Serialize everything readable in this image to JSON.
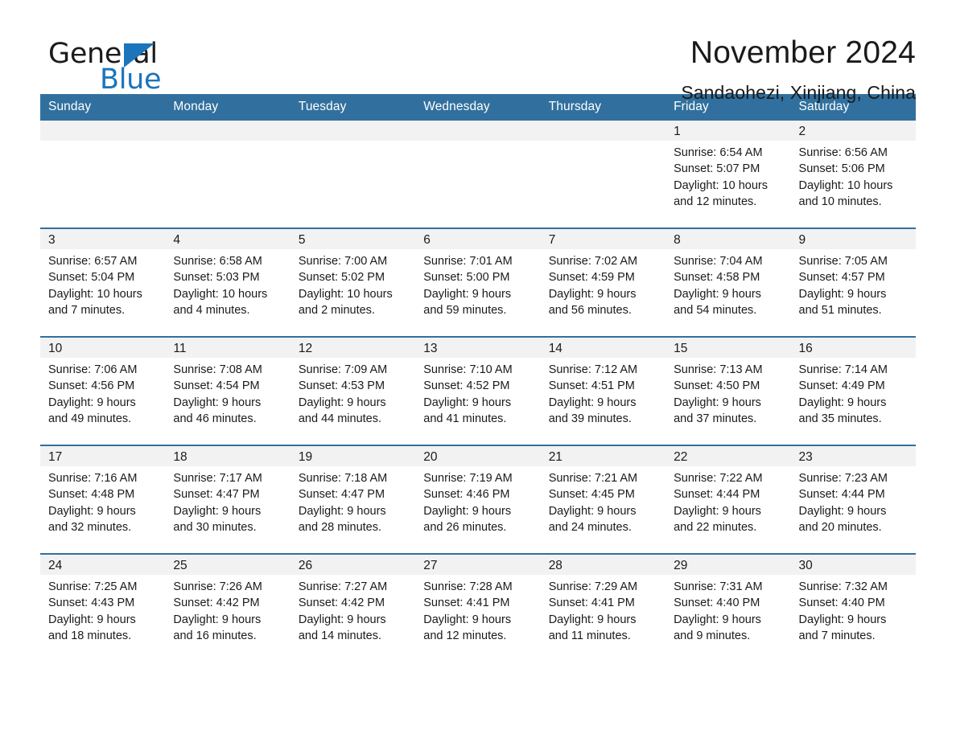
{
  "brand": {
    "name_part1": "General",
    "name_part2": "Blue",
    "triangle_color": "#1b75bb"
  },
  "header": {
    "month_title": "November 2024",
    "location": "Sandaohezi, Xinjiang, China"
  },
  "theme": {
    "header_blue": "#31709e",
    "daynum_band": "#f2f2f2",
    "page_background": "#ffffff"
  },
  "calendar": {
    "weekday_headers": [
      "Sunday",
      "Monday",
      "Tuesday",
      "Wednesday",
      "Thursday",
      "Friday",
      "Saturday"
    ],
    "weeks": [
      [
        {
          "day": "",
          "sunrise": "",
          "sunset": "",
          "daylight": "",
          "empty": true
        },
        {
          "day": "",
          "sunrise": "",
          "sunset": "",
          "daylight": "",
          "empty": true
        },
        {
          "day": "",
          "sunrise": "",
          "sunset": "",
          "daylight": "",
          "empty": true
        },
        {
          "day": "",
          "sunrise": "",
          "sunset": "",
          "daylight": "",
          "empty": true
        },
        {
          "day": "",
          "sunrise": "",
          "sunset": "",
          "daylight": "",
          "empty": true
        },
        {
          "day": "1",
          "sunrise": "Sunrise: 6:54 AM",
          "sunset": "Sunset: 5:07 PM",
          "daylight": "Daylight: 10 hours and 12 minutes.",
          "empty": false
        },
        {
          "day": "2",
          "sunrise": "Sunrise: 6:56 AM",
          "sunset": "Sunset: 5:06 PM",
          "daylight": "Daylight: 10 hours and 10 minutes.",
          "empty": false
        }
      ],
      [
        {
          "day": "3",
          "sunrise": "Sunrise: 6:57 AM",
          "sunset": "Sunset: 5:04 PM",
          "daylight": "Daylight: 10 hours and 7 minutes.",
          "empty": false
        },
        {
          "day": "4",
          "sunrise": "Sunrise: 6:58 AM",
          "sunset": "Sunset: 5:03 PM",
          "daylight": "Daylight: 10 hours and 4 minutes.",
          "empty": false
        },
        {
          "day": "5",
          "sunrise": "Sunrise: 7:00 AM",
          "sunset": "Sunset: 5:02 PM",
          "daylight": "Daylight: 10 hours and 2 minutes.",
          "empty": false
        },
        {
          "day": "6",
          "sunrise": "Sunrise: 7:01 AM",
          "sunset": "Sunset: 5:00 PM",
          "daylight": "Daylight: 9 hours and 59 minutes.",
          "empty": false
        },
        {
          "day": "7",
          "sunrise": "Sunrise: 7:02 AM",
          "sunset": "Sunset: 4:59 PM",
          "daylight": "Daylight: 9 hours and 56 minutes.",
          "empty": false
        },
        {
          "day": "8",
          "sunrise": "Sunrise: 7:04 AM",
          "sunset": "Sunset: 4:58 PM",
          "daylight": "Daylight: 9 hours and 54 minutes.",
          "empty": false
        },
        {
          "day": "9",
          "sunrise": "Sunrise: 7:05 AM",
          "sunset": "Sunset: 4:57 PM",
          "daylight": "Daylight: 9 hours and 51 minutes.",
          "empty": false
        }
      ],
      [
        {
          "day": "10",
          "sunrise": "Sunrise: 7:06 AM",
          "sunset": "Sunset: 4:56 PM",
          "daylight": "Daylight: 9 hours and 49 minutes.",
          "empty": false
        },
        {
          "day": "11",
          "sunrise": "Sunrise: 7:08 AM",
          "sunset": "Sunset: 4:54 PM",
          "daylight": "Daylight: 9 hours and 46 minutes.",
          "empty": false
        },
        {
          "day": "12",
          "sunrise": "Sunrise: 7:09 AM",
          "sunset": "Sunset: 4:53 PM",
          "daylight": "Daylight: 9 hours and 44 minutes.",
          "empty": false
        },
        {
          "day": "13",
          "sunrise": "Sunrise: 7:10 AM",
          "sunset": "Sunset: 4:52 PM",
          "daylight": "Daylight: 9 hours and 41 minutes.",
          "empty": false
        },
        {
          "day": "14",
          "sunrise": "Sunrise: 7:12 AM",
          "sunset": "Sunset: 4:51 PM",
          "daylight": "Daylight: 9 hours and 39 minutes.",
          "empty": false
        },
        {
          "day": "15",
          "sunrise": "Sunrise: 7:13 AM",
          "sunset": "Sunset: 4:50 PM",
          "daylight": "Daylight: 9 hours and 37 minutes.",
          "empty": false
        },
        {
          "day": "16",
          "sunrise": "Sunrise: 7:14 AM",
          "sunset": "Sunset: 4:49 PM",
          "daylight": "Daylight: 9 hours and 35 minutes.",
          "empty": false
        }
      ],
      [
        {
          "day": "17",
          "sunrise": "Sunrise: 7:16 AM",
          "sunset": "Sunset: 4:48 PM",
          "daylight": "Daylight: 9 hours and 32 minutes.",
          "empty": false
        },
        {
          "day": "18",
          "sunrise": "Sunrise: 7:17 AM",
          "sunset": "Sunset: 4:47 PM",
          "daylight": "Daylight: 9 hours and 30 minutes.",
          "empty": false
        },
        {
          "day": "19",
          "sunrise": "Sunrise: 7:18 AM",
          "sunset": "Sunset: 4:47 PM",
          "daylight": "Daylight: 9 hours and 28 minutes.",
          "empty": false
        },
        {
          "day": "20",
          "sunrise": "Sunrise: 7:19 AM",
          "sunset": "Sunset: 4:46 PM",
          "daylight": "Daylight: 9 hours and 26 minutes.",
          "empty": false
        },
        {
          "day": "21",
          "sunrise": "Sunrise: 7:21 AM",
          "sunset": "Sunset: 4:45 PM",
          "daylight": "Daylight: 9 hours and 24 minutes.",
          "empty": false
        },
        {
          "day": "22",
          "sunrise": "Sunrise: 7:22 AM",
          "sunset": "Sunset: 4:44 PM",
          "daylight": "Daylight: 9 hours and 22 minutes.",
          "empty": false
        },
        {
          "day": "23",
          "sunrise": "Sunrise: 7:23 AM",
          "sunset": "Sunset: 4:44 PM",
          "daylight": "Daylight: 9 hours and 20 minutes.",
          "empty": false
        }
      ],
      [
        {
          "day": "24",
          "sunrise": "Sunrise: 7:25 AM",
          "sunset": "Sunset: 4:43 PM",
          "daylight": "Daylight: 9 hours and 18 minutes.",
          "empty": false
        },
        {
          "day": "25",
          "sunrise": "Sunrise: 7:26 AM",
          "sunset": "Sunset: 4:42 PM",
          "daylight": "Daylight: 9 hours and 16 minutes.",
          "empty": false
        },
        {
          "day": "26",
          "sunrise": "Sunrise: 7:27 AM",
          "sunset": "Sunset: 4:42 PM",
          "daylight": "Daylight: 9 hours and 14 minutes.",
          "empty": false
        },
        {
          "day": "27",
          "sunrise": "Sunrise: 7:28 AM",
          "sunset": "Sunset: 4:41 PM",
          "daylight": "Daylight: 9 hours and 12 minutes.",
          "empty": false
        },
        {
          "day": "28",
          "sunrise": "Sunrise: 7:29 AM",
          "sunset": "Sunset: 4:41 PM",
          "daylight": "Daylight: 9 hours and 11 minutes.",
          "empty": false
        },
        {
          "day": "29",
          "sunrise": "Sunrise: 7:31 AM",
          "sunset": "Sunset: 4:40 PM",
          "daylight": "Daylight: 9 hours and 9 minutes.",
          "empty": false
        },
        {
          "day": "30",
          "sunrise": "Sunrise: 7:32 AM",
          "sunset": "Sunset: 4:40 PM",
          "daylight": "Daylight: 9 hours and 7 minutes.",
          "empty": false
        }
      ]
    ]
  }
}
